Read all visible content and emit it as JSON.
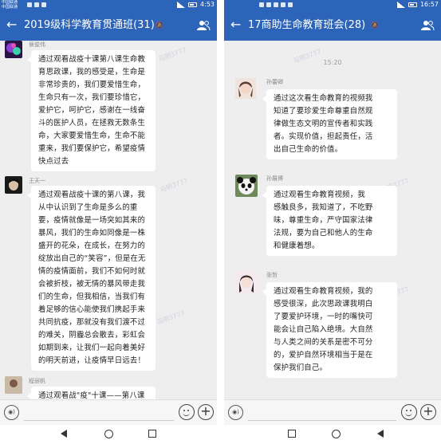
{
  "left": {
    "status": {
      "carrier_line1": "中国联通 ",
      "carrier_line2": "中国联通 ",
      "signal": "4G",
      "battery": "",
      "time": "4:53"
    },
    "header": {
      "back_icon": "back-arrow-icon",
      "title": "2019级科学教育贯通班(31)",
      "mute_icon": "mute-icon",
      "members_icon": "group-members-icon"
    },
    "watermark": "马明3777",
    "messages": [
      {
        "sender": "侯俊伟",
        "avatar": "avatar-purple-art",
        "lines": [
          "通过观看战疫十课第八课生命教",
          "育思政课，我的感受是，生命是",
          "非常珍贵的，我们要爱惜生命，",
          "生命只有一次，我们要珍惜它，",
          "爱护它，呵护它，感谢在一线奋",
          "斗的医护人员，在拯救无数条生",
          "命，大家要爱惜生命，生命不能",
          "重来，我们要保护它，希望疫情",
          "快点过去"
        ]
      },
      {
        "sender": "王天一",
        "avatar": "avatar-dark-portrait",
        "lines": [
          "通过观看战疫十课的第八课，我",
          "从中认识到了生命是多么的重",
          "要，疫情就像是一场突如其来的",
          "暴风，我们的生命如同像是一株",
          "盛开的花朵，在成长，在努力的",
          "绽放出自己的“笑容”，但是在无",
          "情的疫情面前，我们不如何时就",
          "会被折枝，被无情的暴风带走我",
          "们的生命，但我相信，当我们有",
          "着足够的信心能使我们携起手来",
          "共同抗疫，那就没有我们渡不过",
          "的难关，阴霾总会散去，彩虹会",
          "如期到来，让我们一起向着美好",
          "的明天前进，让疫情早日远去！"
        ]
      },
      {
        "sender": "程丽帆",
        "avatar": "avatar-partial",
        "lines": [
          "通过观看战\"疫\"十课——第八课"
        ]
      }
    ],
    "input": {
      "voice_icon": "voice-input-icon",
      "emoji_icon": "emoji-icon",
      "plus_icon": "add-more-icon"
    }
  },
  "right": {
    "status": {
      "signal": "4G",
      "battery": "",
      "time": "16:57"
    },
    "header": {
      "back_icon": "back-arrow-icon",
      "title": "17商助生命教育班会(28)",
      "mute_icon": "mute-icon",
      "members_icon": "group-members-icon"
    },
    "timestamp": "15:20",
    "watermark": "马明3777",
    "messages": [
      {
        "sender": "孙蕾卿",
        "avatar": "avatar-girl-portrait",
        "lines": [
          "通过这次看生命教育的视频我",
          "知道了要珍爱生命尊重自然规",
          "律做生态文明的宣传者和实践",
          "者。实现价值，担起责任，活",
          "出自己生命的价值。"
        ]
      },
      {
        "sender": "孙展博",
        "avatar": "avatar-panda",
        "lines": [
          "通过观看生命教育视频，我",
          "感触良多，我知道了，不吃野",
          "味，尊重生命，严守国家法律",
          "法规，要为自己和他人的生命",
          "和健康着想。"
        ]
      },
      {
        "sender": "张哲",
        "avatar": "avatar-girl-light",
        "lines": [
          "通过观看生命教育视频，我的",
          "感受很深，此次思政课我明白",
          "了要爱护环境，一时的嘴快可",
          "能会让自己陷入绝境。大自然",
          "与人类之间的关系是密不可分",
          "的，爱护自然环境相当于是在",
          "保护我们自己。"
        ]
      }
    ],
    "input": {
      "voice_icon": "voice-input-icon",
      "emoji_icon": "emoji-icon",
      "plus_icon": "add-more-icon"
    }
  },
  "colors": {
    "header_blue": "#2c64ba",
    "chat_bg": "#eeeeee",
    "bubble_bg": "#ffffff"
  }
}
